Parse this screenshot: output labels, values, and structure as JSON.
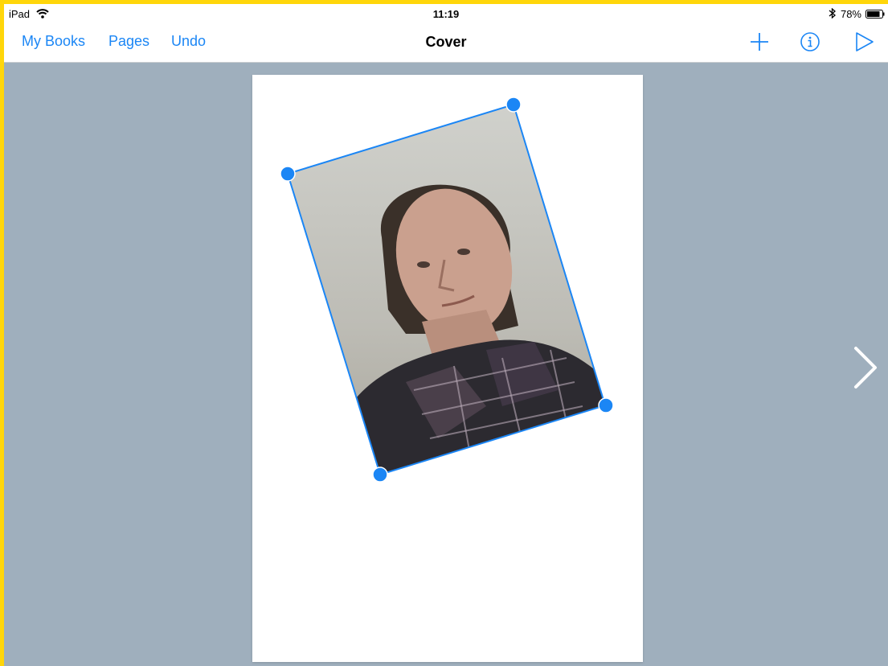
{
  "status_bar": {
    "device": "iPad",
    "time": "11:19",
    "battery": "78%",
    "wifi_icon": "wifi-icon",
    "bluetooth_icon": "bluetooth-icon",
    "battery_icon": "battery-icon"
  },
  "nav": {
    "my_books": "My Books",
    "pages": "Pages",
    "undo": "Undo",
    "title": "Cover",
    "add_icon": "plus-icon",
    "info_icon": "info-icon",
    "play_icon": "play-icon"
  },
  "colors": {
    "accent": "#1b86f5",
    "background": "#9fafbd",
    "frame": "#ffd60a",
    "page": "#ffffff"
  },
  "canvas": {
    "selected_item": "photo",
    "next_icon": "chevron-right-icon"
  }
}
